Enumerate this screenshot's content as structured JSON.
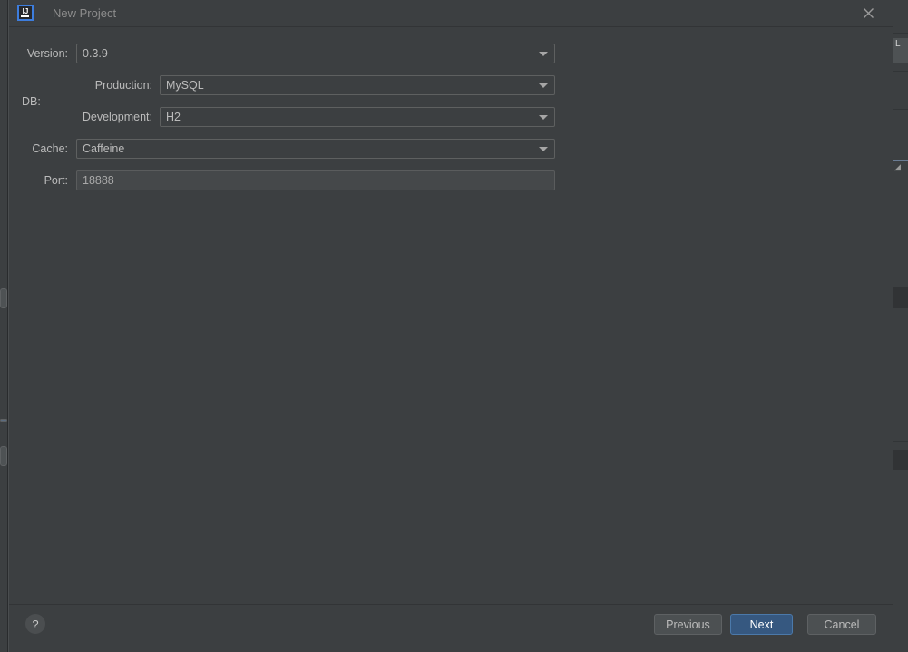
{
  "window": {
    "title": "New Project",
    "app_icon": "intellij-idea-icon",
    "close_icon": "close-icon",
    "accent_blue": "#365880",
    "background": "#3c3f41",
    "text_color": "#bbbbbb"
  },
  "form": {
    "fields": [
      {
        "id": "version",
        "label": "Version:",
        "value": "0.3.9",
        "type": "combobox",
        "icon": "chevron-down-icon"
      },
      {
        "id": "db-production",
        "group_label": "DB:",
        "label": "Production:",
        "value": "MySQL",
        "type": "combobox",
        "icon": "chevron-down-icon"
      },
      {
        "id": "db-development",
        "label": "Development:",
        "value": "H2",
        "type": "combobox",
        "icon": "chevron-down-icon"
      },
      {
        "id": "cache",
        "label": "Cache:",
        "value": "Caffeine",
        "type": "combobox",
        "icon": "chevron-down-icon"
      },
      {
        "id": "port",
        "label": "Port:",
        "value": "18888",
        "type": "textfield"
      }
    ],
    "db_group_label": "DB:"
  },
  "footer": {
    "help_label": "?",
    "buttons": [
      {
        "id": "previous",
        "label": "Previous",
        "primary": false
      },
      {
        "id": "next",
        "label": "Next",
        "primary": true
      },
      {
        "id": "cancel",
        "label": "Cancel",
        "primary": false
      }
    ]
  },
  "backdrop": {
    "right_tab_label": "L"
  }
}
